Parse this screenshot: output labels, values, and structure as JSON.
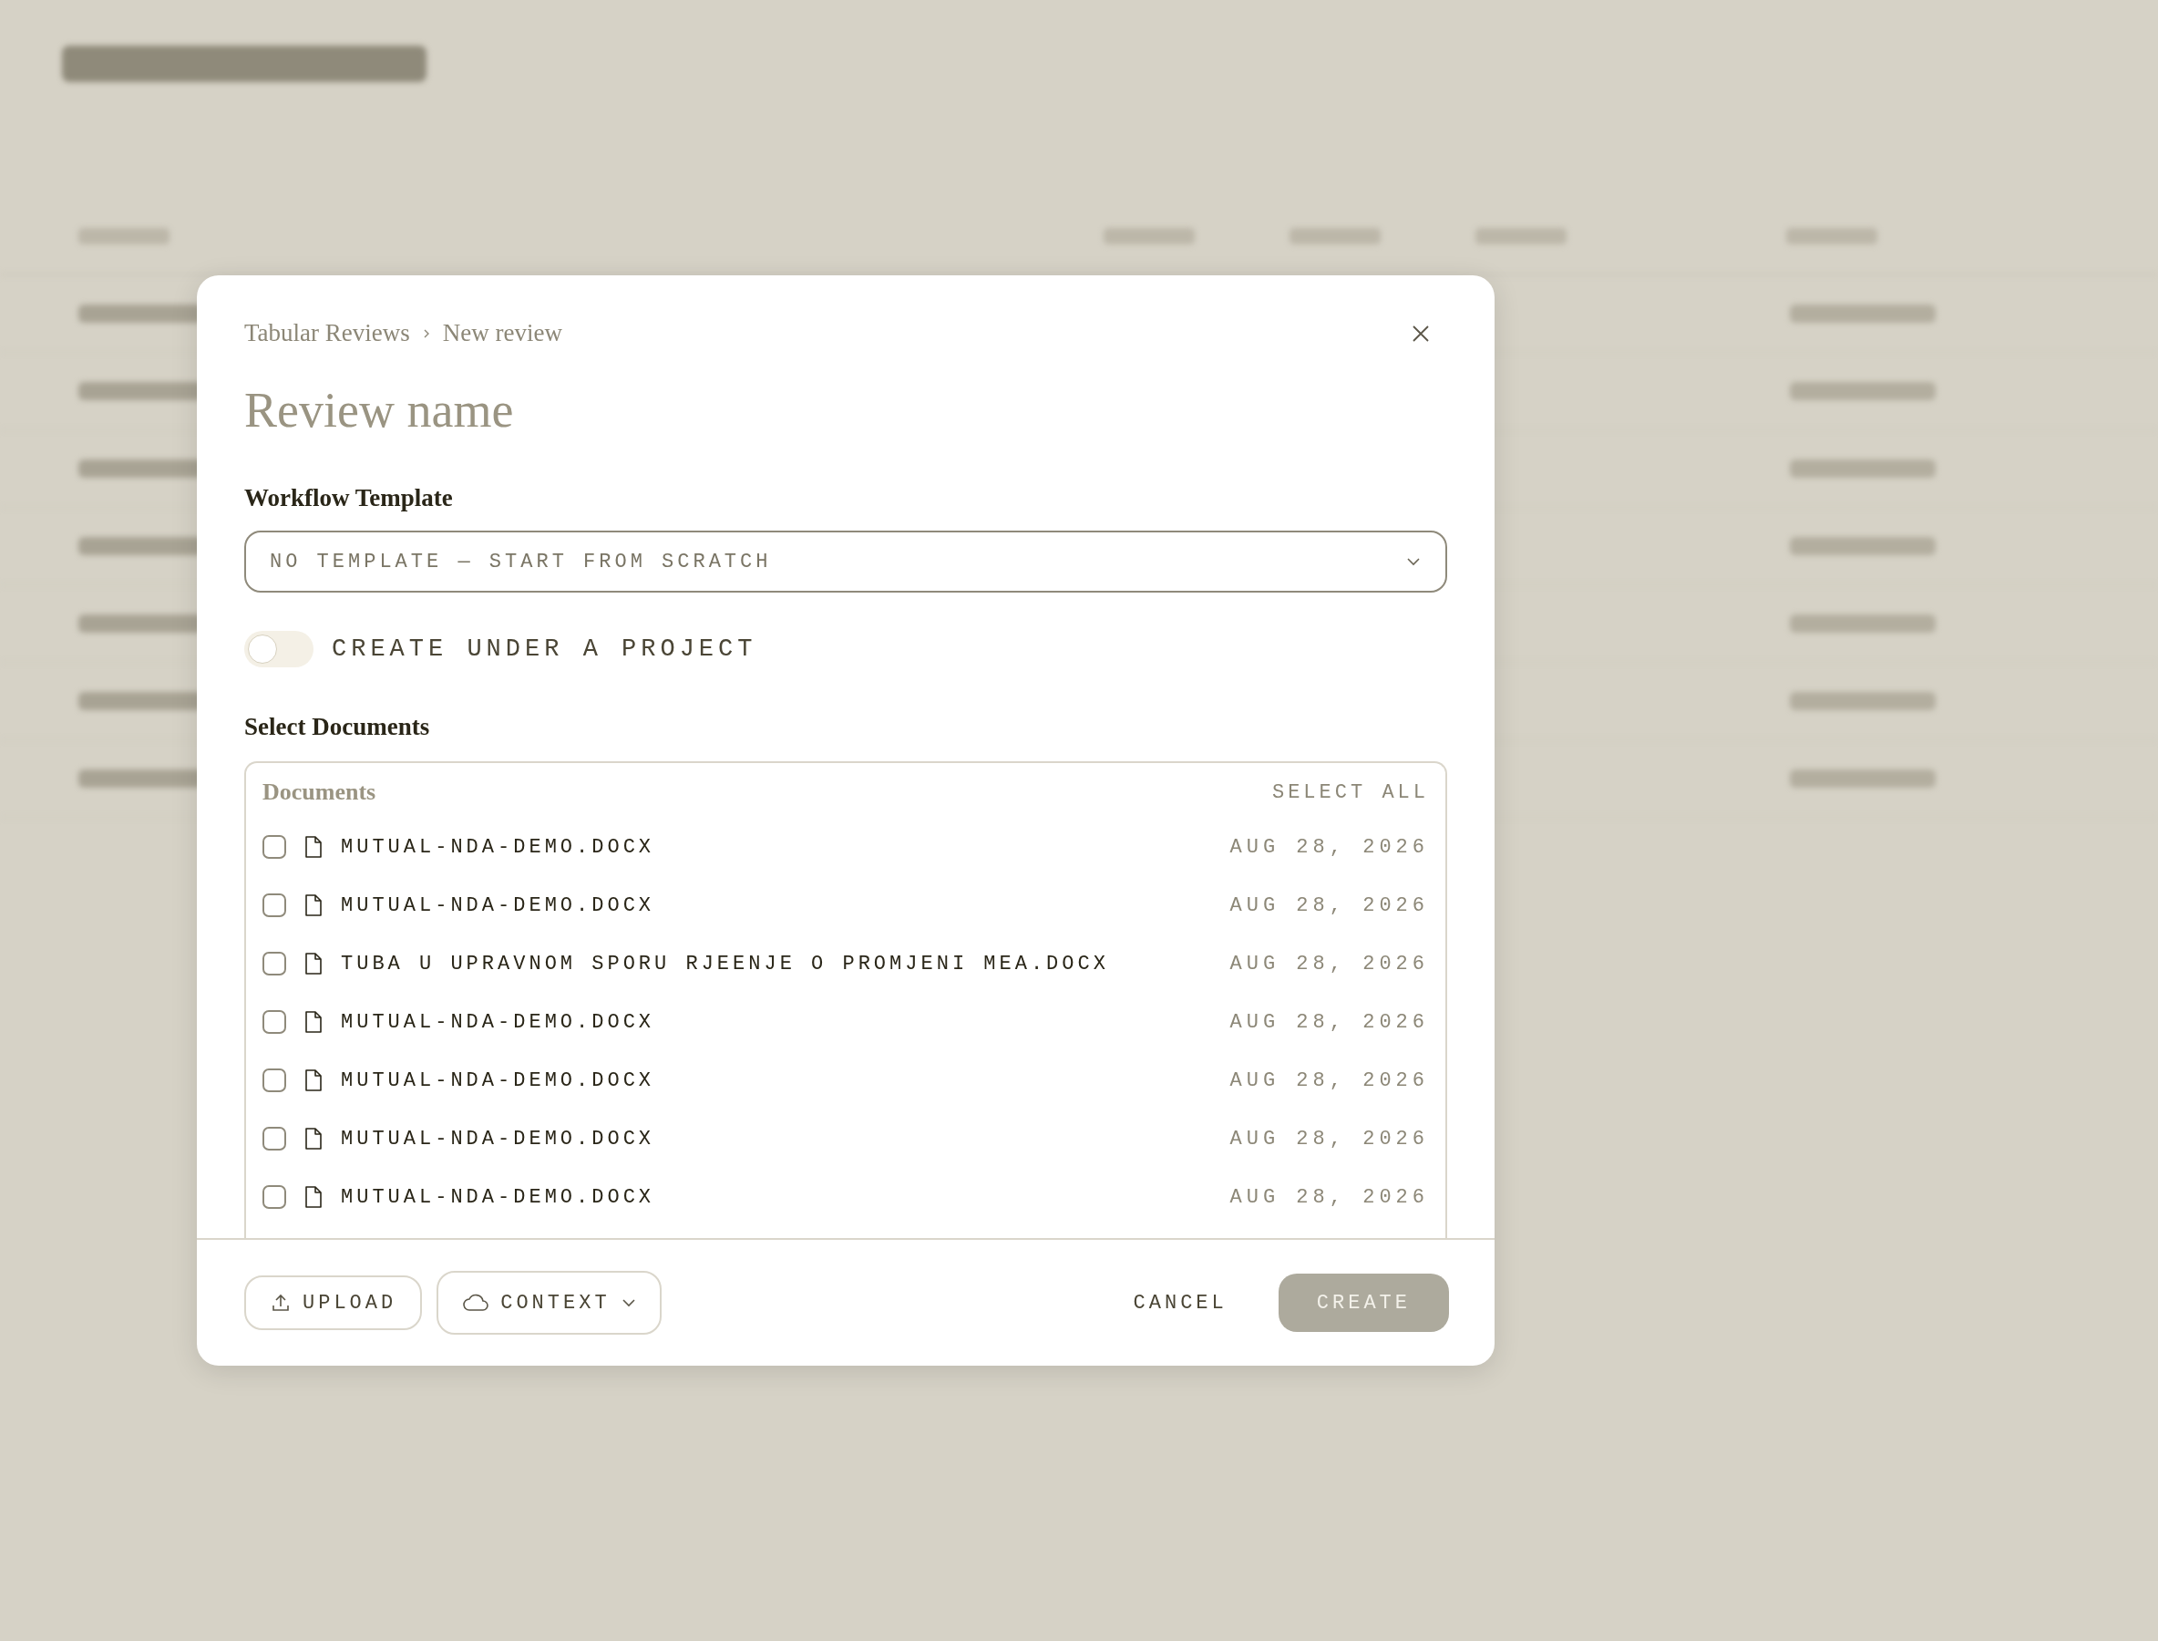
{
  "dialog": {
    "breadcrumb": [
      "Tabular Reviews",
      "New review"
    ],
    "name_placeholder": "Review name",
    "template_label": "Workflow Template",
    "template_value": "NO TEMPLATE — START FROM SCRATCH",
    "project_toggle": {
      "label": "CREATE UNDER A PROJECT",
      "on": false
    },
    "documents_label": "Select Documents",
    "documents": {
      "header": "Documents",
      "select_all": "SELECT ALL",
      "rows": [
        {
          "name": "MUTUAL-NDA-DEMO.DOCX",
          "date": "AUG 28, 2026",
          "checked": false
        },
        {
          "name": "MUTUAL-NDA-DEMO.DOCX",
          "date": "AUG 28, 2026",
          "checked": false
        },
        {
          "name": "TUBA U UPRAVNOM SPORU RJEENJE O PROMJENI MEA.DOCX",
          "date": "AUG 28, 2026",
          "checked": false
        },
        {
          "name": "MUTUAL-NDA-DEMO.DOCX",
          "date": "AUG 28, 2026",
          "checked": false
        },
        {
          "name": "MUTUAL-NDA-DEMO.DOCX",
          "date": "AUG 28, 2026",
          "checked": false
        },
        {
          "name": "MUTUAL-NDA-DEMO.DOCX",
          "date": "AUG 28, 2026",
          "checked": false
        },
        {
          "name": "MUTUAL-NDA-DEMO.DOCX",
          "date": "AUG 28, 2026",
          "checked": false
        }
      ]
    },
    "footer": {
      "upload": "UPLOAD",
      "context": "CONTEXT",
      "cancel": "CANCEL",
      "create": "CREATE",
      "create_disabled": true
    }
  }
}
